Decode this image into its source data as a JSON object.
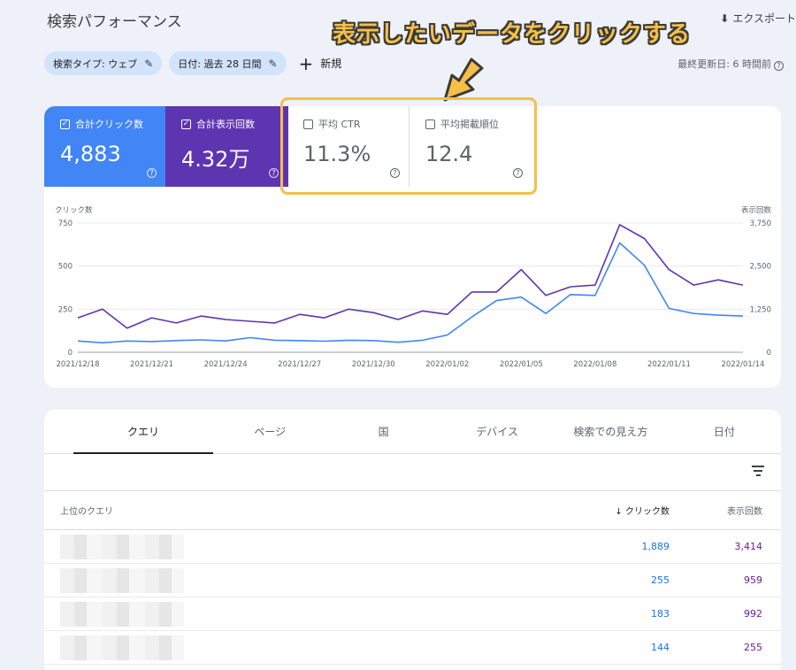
{
  "header": {
    "title": "検索パフォーマンス",
    "export_label": "エクスポート",
    "updated": "最終更新日: 6 時間前"
  },
  "filters": {
    "search_type": "検索タイプ: ウェブ",
    "date": "日付: 過去 28 日間",
    "new_label": "新規"
  },
  "annotation": "表示したいデータをクリックする",
  "metrics": {
    "clicks": {
      "label": "合計クリック数",
      "value": "4,883",
      "checked": true
    },
    "impressions": {
      "label": "合計表示回数",
      "value": "4.32万",
      "checked": true
    },
    "ctr": {
      "label": "平均 CTR",
      "value": "11.3%",
      "checked": false
    },
    "position": {
      "label": "平均掲載順位",
      "value": "12.4",
      "checked": false
    }
  },
  "colors": {
    "clicks": "#4285f4",
    "impressions": "#5e35b1",
    "accent_highlight": "#f6bf48"
  },
  "chart_data": {
    "type": "line",
    "ylabel_left": "クリック数",
    "ylabel_right": "表示回数",
    "ylim_left": [
      0,
      750
    ],
    "ylim_right": [
      0,
      3750
    ],
    "yticks_left": [
      "750",
      "500",
      "250",
      "0"
    ],
    "yticks_right": [
      "3,750",
      "2,500",
      "1,250",
      "0"
    ],
    "x_tick_labels": [
      "2021/12/18",
      "2021/12/21",
      "2021/12/24",
      "2021/12/27",
      "2021/12/30",
      "2022/01/02",
      "2022/01/05",
      "2022/01/08",
      "2022/01/11",
      "2022/01/14"
    ],
    "x": [
      "2021/12/18",
      "2021/12/19",
      "2021/12/20",
      "2021/12/21",
      "2021/12/22",
      "2021/12/23",
      "2021/12/24",
      "2021/12/25",
      "2021/12/26",
      "2021/12/27",
      "2021/12/28",
      "2021/12/29",
      "2021/12/30",
      "2021/12/31",
      "2022/01/01",
      "2022/01/02",
      "2022/01/03",
      "2022/01/04",
      "2022/01/05",
      "2022/01/06",
      "2022/01/07",
      "2022/01/08",
      "2022/01/09",
      "2022/01/10",
      "2022/01/11",
      "2022/01/12",
      "2022/01/13",
      "2022/01/14"
    ],
    "series": [
      {
        "name": "クリック数",
        "axis": "left",
        "values": [
          65,
          55,
          65,
          62,
          68,
          72,
          66,
          85,
          70,
          68,
          64,
          70,
          68,
          58,
          70,
          100,
          205,
          300,
          320,
          225,
          335,
          330,
          635,
          505,
          255,
          225,
          215,
          210
        ]
      },
      {
        "name": "表示回数",
        "axis": "right",
        "values": [
          1000,
          1250,
          700,
          1000,
          850,
          1050,
          950,
          900,
          850,
          1100,
          1000,
          1250,
          1150,
          950,
          1200,
          1100,
          1750,
          1750,
          2400,
          1650,
          1900,
          1950,
          3700,
          3300,
          2400,
          1950,
          2100,
          1950
        ]
      }
    ],
    "grid": true
  },
  "table": {
    "tabs": [
      "クエリ",
      "ページ",
      "国",
      "デバイス",
      "検索での見え方",
      "日付"
    ],
    "active_tab": 0,
    "headers": {
      "query": "上位のクエリ",
      "clicks": "クリック数",
      "impressions": "表示回数"
    },
    "rows": [
      {
        "clicks": "1,889",
        "impressions": "3,414"
      },
      {
        "clicks": "255",
        "impressions": "959"
      },
      {
        "clicks": "183",
        "impressions": "992"
      },
      {
        "clicks": "144",
        "impressions": "255"
      }
    ]
  }
}
